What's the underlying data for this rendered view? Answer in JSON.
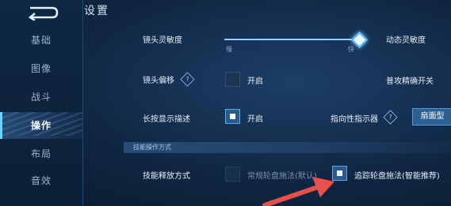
{
  "sidebar": {
    "items": [
      {
        "label": "基础"
      },
      {
        "label": "图像"
      },
      {
        "label": "战斗"
      },
      {
        "label": "操作"
      },
      {
        "label": "布局"
      },
      {
        "label": "音效"
      }
    ],
    "active_index": 3
  },
  "header": {
    "title": "设置"
  },
  "settings": {
    "camera_sensitivity": {
      "label": "镜头灵敏度",
      "slow": "慢",
      "fast": "快",
      "value_fraction": 0.98
    },
    "dynamic_sensitivity": {
      "label": "动态灵敏度"
    },
    "camera_offset": {
      "label": "镜头偏移",
      "option": "开启",
      "checked": false
    },
    "normal_attack_precision": {
      "label": "普攻精确开关"
    },
    "long_press_description": {
      "label": "长按显示描述",
      "option": "开启",
      "checked": true
    },
    "directional_indicator": {
      "label": "指向性指示器",
      "button": "扇面型"
    },
    "skill_section": {
      "title": "技能操作方式"
    },
    "skill_release": {
      "label": "技能释放方式",
      "option_normal": "常规轮盘施法(默认)",
      "option_tracking": "追踪轮盘施法(智能推荐)",
      "selected": "tracking"
    }
  },
  "colors": {
    "accent": "#5bb4ff",
    "arrow": "#e8504a"
  }
}
